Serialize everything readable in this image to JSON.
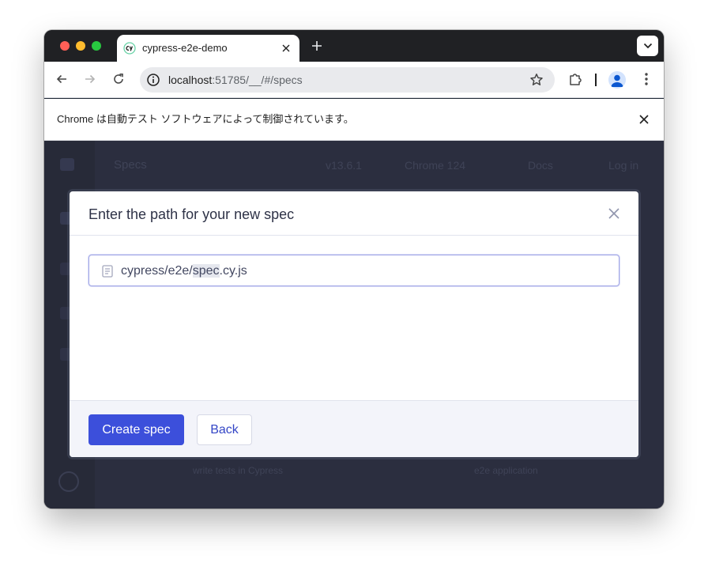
{
  "tab": {
    "title": "cypress-e2e-demo",
    "favicon": "cypress-logo-icon"
  },
  "omnibox": {
    "host": "localhost",
    "path": ":51785/__/#/specs"
  },
  "infobar": {
    "message": "Chrome は自動テスト ソフトウェアによって制御されています。"
  },
  "background_app": {
    "page_title": "Specs",
    "version": "v13.6.1",
    "browser": "Chrome 124",
    "docs_label": "Docs",
    "login_label": "Log in",
    "bottom_left": "write tests in Cypress",
    "bottom_right": "e2e application"
  },
  "modal": {
    "title": "Enter the path for your new spec",
    "input_prefix": "cypress/e2e/",
    "input_selected": "spec",
    "input_suffix": ".cy.js",
    "create_label": "Create spec",
    "back_label": "Back"
  },
  "colors": {
    "primary": "#3c4fdb",
    "modal_overlay": "#2b2e3f",
    "input_focus": "#a3a8e6"
  }
}
